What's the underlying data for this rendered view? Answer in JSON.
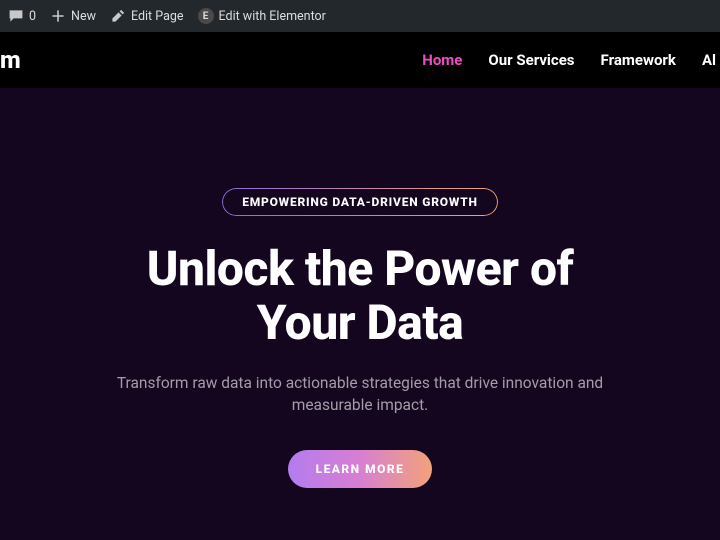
{
  "wpbar": {
    "comments_count": "0",
    "new_label": "New",
    "edit_page_label": "Edit Page",
    "edit_elementor_label": "Edit with Elementor",
    "elementor_icon_letter": "E"
  },
  "nav": {
    "logo_fragment": "m",
    "items": [
      {
        "label": "Home",
        "active": true
      },
      {
        "label": "Our Services",
        "active": false
      },
      {
        "label": "Framework",
        "active": false
      },
      {
        "label": "Al",
        "active": false
      }
    ]
  },
  "hero": {
    "badge": "EMPOWERING DATA-DRIVEN GROWTH",
    "headline_line1": "Unlock the Power of",
    "headline_line2": "Your Data",
    "subhead": "Transform raw data into actionable strategies that drive innovation and measurable impact.",
    "cta_label": "LEARN MORE"
  }
}
